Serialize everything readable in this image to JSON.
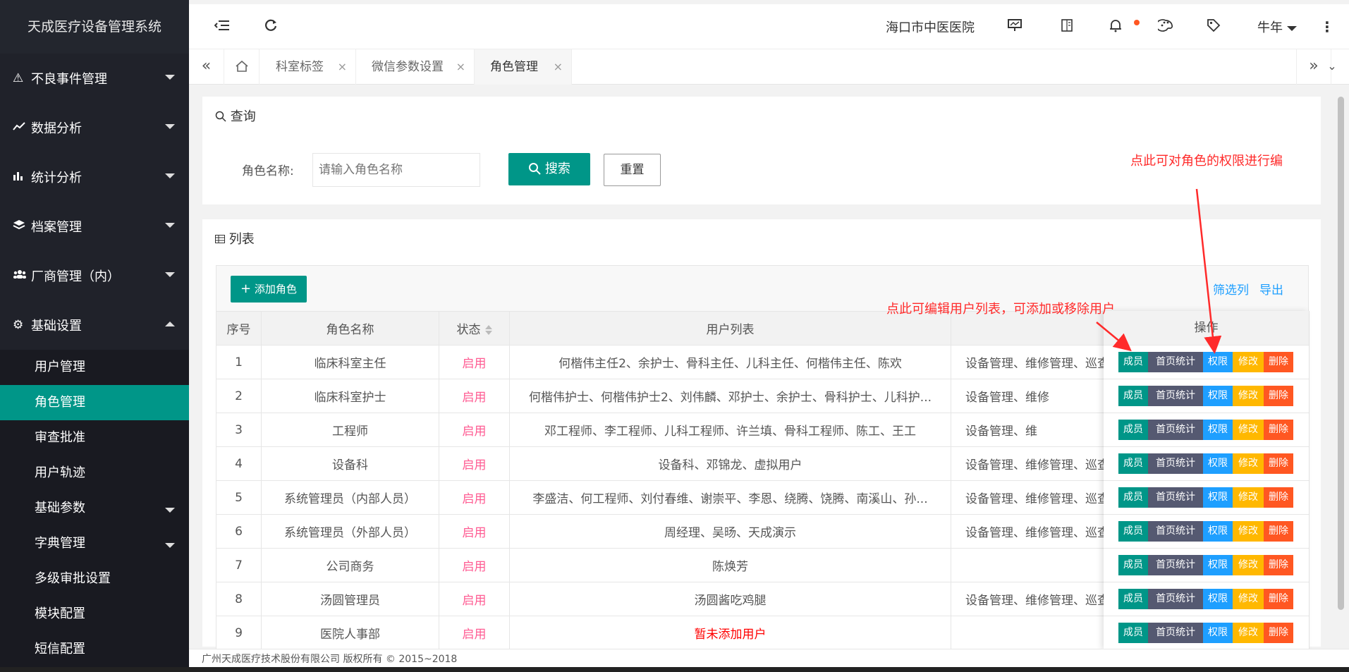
{
  "app": {
    "title": "天成医疗设备管理系统"
  },
  "sidebar": {
    "groups": [
      {
        "icon": "warning-icon",
        "label": "不良事件管理"
      },
      {
        "icon": "chart-line-icon",
        "label": "数据分析"
      },
      {
        "icon": "bar-chart-icon",
        "label": "统计分析"
      },
      {
        "icon": "layers-icon",
        "label": "档案管理"
      },
      {
        "icon": "users-icon",
        "label": "厂商管理（内）"
      },
      {
        "icon": "gear-icon",
        "label": "基础设置"
      }
    ],
    "sub_items": [
      "用户管理",
      "角色管理",
      "审查批准",
      "用户轨迹",
      "基础参数",
      "字典管理",
      "多级审批设置",
      "模块配置",
      "短信配置"
    ]
  },
  "header": {
    "hospital": "海口市中医医院",
    "user": "牛年"
  },
  "tabs": {
    "items": [
      "科室标签",
      "微信参数设置",
      "角色管理"
    ],
    "close": "×"
  },
  "query": {
    "title": "查询",
    "role_label": "角色名称:",
    "role_placeholder": "请输入角色名称",
    "search_label": "搜索",
    "reset_label": "重置"
  },
  "list": {
    "title": "列表",
    "add_label": "添加角色",
    "filter_label": "筛选列",
    "export_label": "导出",
    "columns": [
      "序号",
      "角色名称",
      "状态",
      "用户列表",
      "操作"
    ],
    "rows": [
      {
        "no": "1",
        "name": "临床科室主任",
        "status": "启用",
        "users": "何楷伟主任2、余护士、骨科主任、儿科主任、何楷伟主任、陈欢",
        "perm": "设备管理、维修管理、巡查"
      },
      {
        "no": "2",
        "name": "临床科室护士",
        "status": "启用",
        "users": "何楷伟护士、何楷伟护士2、刘伟麟、邓护士、余护士、骨科护士、儿科护...",
        "perm": "设备管理、维修"
      },
      {
        "no": "3",
        "name": "工程师",
        "status": "启用",
        "users": "邓工程师、李工程师、儿科工程师、许兰填、骨科工程师、陈工、王工",
        "perm": "设备管理、维"
      },
      {
        "no": "4",
        "name": "设备科",
        "status": "启用",
        "users": "设备科、邓锦龙、虚拟用户",
        "perm": "设备管理、维修管理、巡查"
      },
      {
        "no": "5",
        "name": "系统管理员（内部人员）",
        "status": "启用",
        "users": "李盛洁、何工程师、刘付春维、谢崇平、李恩、绕腾、饶腾、南溪山、孙...",
        "perm": "设备管理、维修管理、巡查"
      },
      {
        "no": "6",
        "name": "系统管理员（外部人员）",
        "status": "启用",
        "users": "周经理、吴旸、天成演示",
        "perm": "设备管理、维修管理、巡查"
      },
      {
        "no": "7",
        "name": "公司商务",
        "status": "启用",
        "users": "陈焕芳",
        "perm": ""
      },
      {
        "no": "8",
        "name": "汤圆管理员",
        "status": "启用",
        "users": "汤圆酱吃鸡腿",
        "perm": "设备管理、维修管理、巡查"
      },
      {
        "no": "9",
        "name": "医院人事部",
        "status": "启用",
        "users": "暂未添加用户",
        "perm": ""
      }
    ],
    "ops": {
      "member": "成员",
      "home_stats": "首页统计",
      "perm": "权限",
      "edit": "修改",
      "delete": "删除"
    }
  },
  "annotations": {
    "perm_note": "点此可对角色的权限进行编",
    "member_note": "点此可编辑用户列表，可添加或移除用户"
  },
  "footer": {
    "copyright": "广州天成医疗技术股份有限公司 版权所有 © 2015~2018"
  },
  "colors": {
    "accent": "#009688",
    "sidebar": "#20222a",
    "status": "#ff5c93",
    "annotation": "#ff2a2a"
  }
}
